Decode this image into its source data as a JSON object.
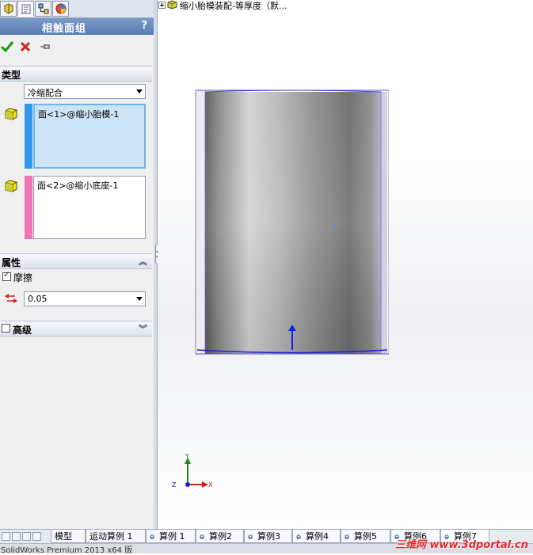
{
  "property_manager": {
    "title": "相触面组",
    "help": "?",
    "type_group": {
      "header": "类型",
      "selected_type": "冷缩配合",
      "selection_1": "面<1>@缩小胎模-1",
      "selection_2": "面<2>@缩小底座-1",
      "selection_1_color": "#3399ee",
      "selection_2_color": "#ee77b8"
    },
    "props_group": {
      "header": "属性",
      "friction_label": "摩擦",
      "friction_checked": true,
      "friction_value": "0.05"
    },
    "advanced_group": {
      "header": "高级",
      "checked": false
    }
  },
  "viewport": {
    "tree_root_label": "缩小胎模装配-等厚度（默...",
    "triad": {
      "y": "Y",
      "x": "X",
      "z": "Z"
    }
  },
  "bottom_tabs": [
    "模型",
    "运动算例 1",
    "算例 1",
    "算例2",
    "算例3",
    "算例4",
    "算例5",
    "算例6",
    "算例7"
  ],
  "active_tab_index": 8,
  "status_bar": "SolidWorks Premium 2013 x64 版",
  "watermark": "三维网 www.3dportal.cn",
  "colors": {
    "accent": "#5a7db3",
    "model_edge": "#3a3aff"
  }
}
